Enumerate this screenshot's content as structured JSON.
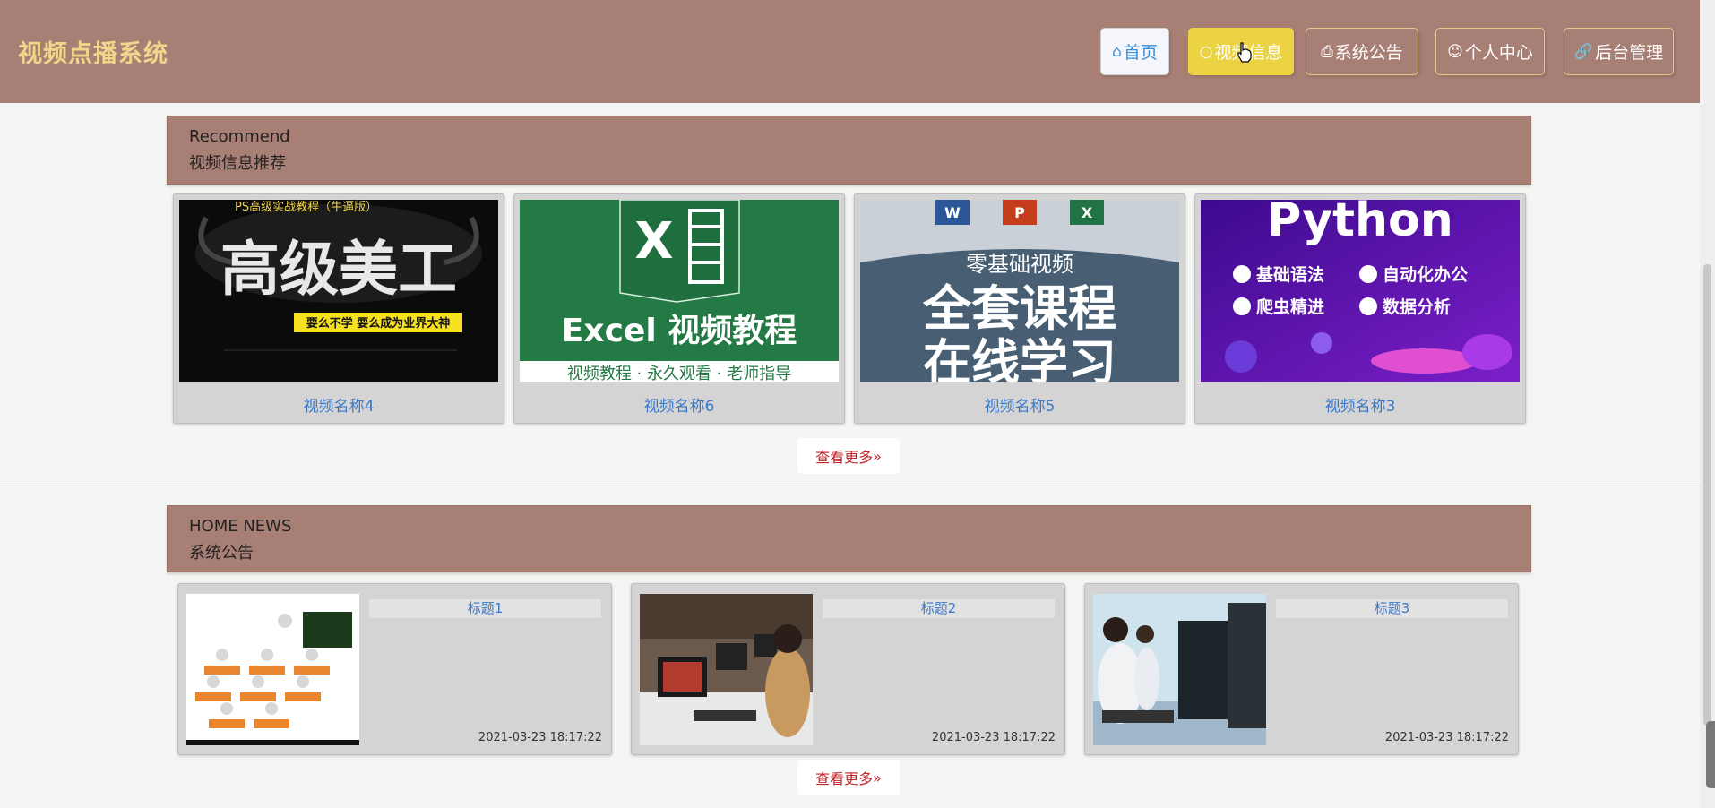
{
  "header": {
    "logo": "视频点播系统",
    "nav": [
      {
        "label": "首页",
        "icon": "home-icon"
      },
      {
        "label": "视频信息",
        "icon": "circle-icon"
      },
      {
        "label": "系统公告",
        "icon": "printer-icon"
      },
      {
        "label": "个人中心",
        "icon": "user-icon"
      },
      {
        "label": "后台管理",
        "icon": "link-icon"
      }
    ]
  },
  "recommend": {
    "title_en": "Recommend",
    "title_zh": "视频信息推荐",
    "videos": [
      {
        "name": "视频名称4",
        "thumb_top": "PS高级实战教程（牛逼版）",
        "thumb_main": "高级美工",
        "thumb_tag": "要么不学  要么成为业界大神"
      },
      {
        "name": "视频名称6",
        "thumb_main": "Excel 视频教程",
        "thumb_sub": "视频教程 · 永久观看 · 老师指导"
      },
      {
        "name": "视频名称5",
        "thumb_top": "零基础视频",
        "thumb_main": "全套课程",
        "thumb_sub": "在线学习"
      },
      {
        "name": "视频名称3",
        "thumb_main": "Python",
        "thumb_b1": "基础语法",
        "thumb_b2": "自动化办公",
        "thumb_b3": "爬虫精进",
        "thumb_b4": "数据分析"
      }
    ],
    "more": "查看更多"
  },
  "news": {
    "title_en": "HOME NEWS",
    "title_zh": "系统公告",
    "items": [
      {
        "title": "标题1",
        "date": "2021-03-23 18:17:22"
      },
      {
        "title": "标题2",
        "date": "2021-03-23 18:17:22"
      },
      {
        "title": "标题3",
        "date": "2021-03-23 18:17:22"
      }
    ],
    "more": "查看更多"
  }
}
